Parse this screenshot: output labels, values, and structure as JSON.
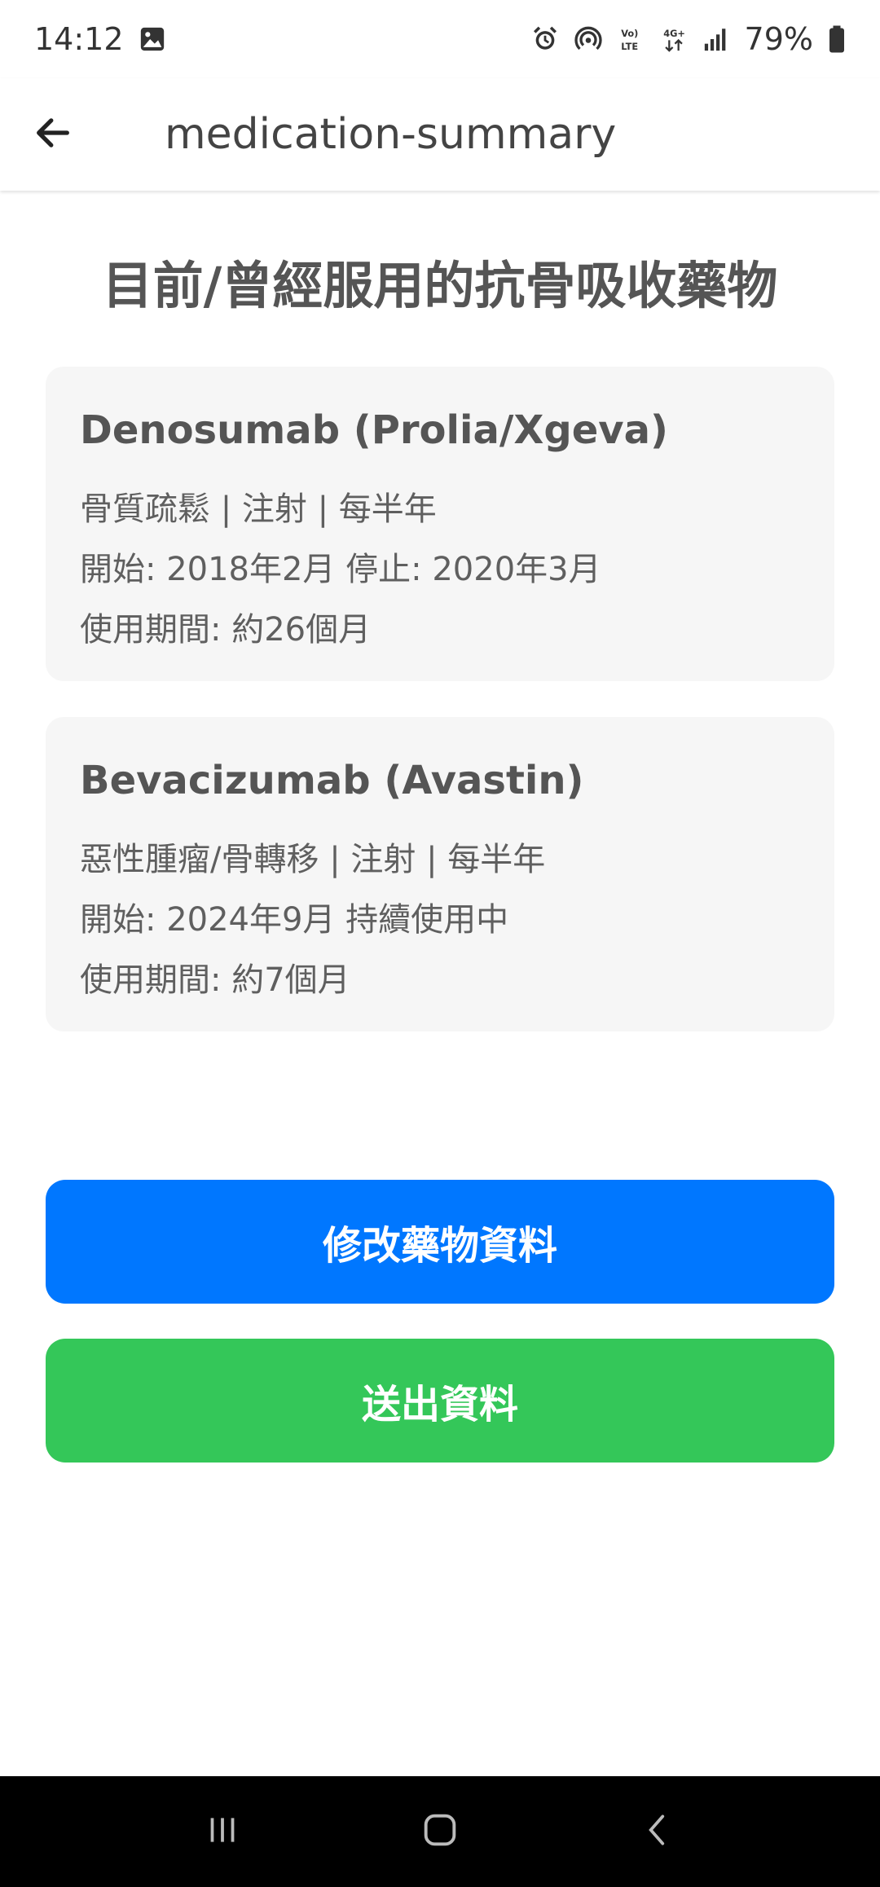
{
  "status_bar": {
    "time": "14:12",
    "battery": "79%",
    "icons": [
      "image-icon",
      "alarm-icon",
      "hotspot-icon",
      "volte-icon",
      "4g-icon",
      "signal-icon",
      "battery-icon"
    ]
  },
  "appbar": {
    "title": "medication-summary"
  },
  "heading": "目前/曾經服用的抗骨吸收藥物",
  "medications": [
    {
      "name": "Denosumab (Prolia/Xgeva)",
      "details": "骨質疏鬆 | 注射 | 每半年",
      "dates": "開始: 2018年2月 停止: 2020年3月",
      "duration": "使用期間: 約26個月"
    },
    {
      "name": "Bevacizumab (Avastin)",
      "details": "惡性腫瘤/骨轉移 | 注射 | 每半年",
      "dates": "開始: 2024年9月 持續使用中",
      "duration": "使用期間: 約7個月"
    }
  ],
  "buttons": {
    "edit_label": "修改藥物資料",
    "submit_label": "送出資料"
  },
  "colors": {
    "edit_button": "#0077ff",
    "submit_button": "#34c759",
    "card_background": "#f6f6f6"
  }
}
